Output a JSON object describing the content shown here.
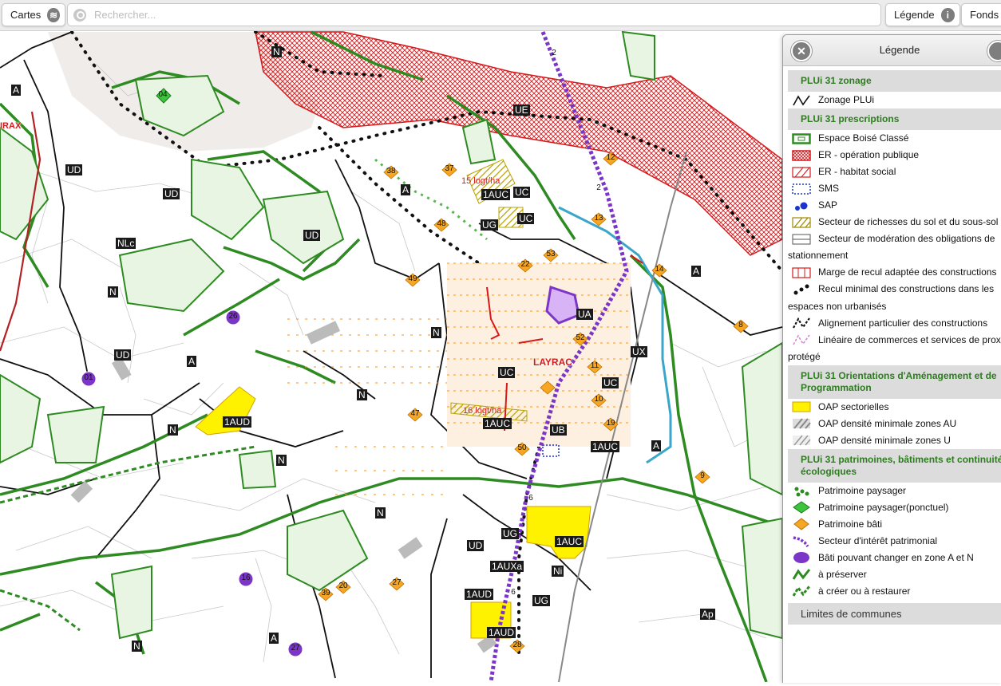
{
  "topbar": {
    "cartes_label": "Cartes",
    "search_placeholder": "Rechercher...",
    "legende_label": "Légende",
    "fonds_label": "Fonds"
  },
  "map": {
    "town_name": "LAYRAC",
    "density_labels": [
      "15 logt/ha",
      "16 logt/ha"
    ],
    "zone_labels": [
      "N",
      "A",
      "UD",
      "UD",
      "NLc",
      "N",
      "UD",
      "UD",
      "A",
      "N",
      "1AUD",
      "N",
      "N",
      "UE",
      "A",
      "1AUC",
      "UC",
      "UC",
      "UG",
      "UA",
      "UC",
      "UX",
      "UC",
      "1AUC",
      "UB",
      "1AUC",
      "A",
      "A",
      "N",
      "UG",
      "UD",
      "1AUC",
      "1AUXa",
      "Ni",
      "1AUD",
      "UG",
      "1AUD",
      "Ap",
      "A",
      "N",
      "N"
    ],
    "left_edge_label": "IRAX",
    "numbered_badges": [
      "04",
      "38",
      "37",
      "12",
      "2",
      "2",
      "13",
      "48",
      "22",
      "53",
      "14",
      "49",
      "26",
      "8",
      "52",
      "11",
      "01",
      "47",
      "10",
      "19",
      "50",
      "9",
      "6",
      "16",
      "39",
      "20",
      "27",
      "6",
      "28",
      "27"
    ]
  },
  "legend": {
    "title": "Légende",
    "sections": [
      {
        "title": "PLUi 31 zonage",
        "items": [
          {
            "icon": "zonage-line-icon",
            "label": "Zonage PLUi"
          }
        ]
      },
      {
        "title": "PLUi 31 prescriptions",
        "items": [
          {
            "icon": "ebc-icon",
            "label": "Espace Boisé Classé"
          },
          {
            "icon": "er-public-icon",
            "label": "ER - opération publique"
          },
          {
            "icon": "er-social-icon",
            "label": "ER - habitat social"
          },
          {
            "icon": "sms-icon",
            "label": "SMS"
          },
          {
            "icon": "sap-icon",
            "label": "SAP"
          },
          {
            "icon": "richesses-icon",
            "label": "Secteur de richesses du sol et du sous-sol"
          },
          {
            "icon": "stationnement-icon",
            "label": "Secteur de modération des obligations de stationnement"
          },
          {
            "icon": "recul-icon",
            "label": "Marge de recul adaptée des constructions"
          },
          {
            "icon": "recul-min-icon",
            "label": "Recul minimal des constructions dans les espaces non urbanisés"
          },
          {
            "icon": "alignement-icon",
            "label": "Alignement particulier des constructions"
          },
          {
            "icon": "lineaire-icon",
            "label": "Linéaire de commerces et services de proximité protégé"
          }
        ]
      },
      {
        "title": "PLUi 31 Orientations d'Aménagement et de Programmation",
        "items": [
          {
            "icon": "oap-sect-icon",
            "label": "OAP sectorielles"
          },
          {
            "icon": "oap-au-icon",
            "label": "OAP densité minimale zones AU"
          },
          {
            "icon": "oap-u-icon",
            "label": "OAP densité minimale zones U"
          }
        ]
      },
      {
        "title": "PLUi 31 patrimoines, bâtiments et continuités écologiques",
        "items": [
          {
            "icon": "pat-paysager-icon",
            "label": "Patrimoine paysager"
          },
          {
            "icon": "pat-ponctuel-icon",
            "label": "Patrimoine paysager(ponctuel)"
          },
          {
            "icon": "pat-bati-icon",
            "label": "Patrimoine bâti"
          },
          {
            "icon": "secteur-patrimonial-icon",
            "label": "Secteur d'intérêt patrimonial"
          },
          {
            "icon": "bati-changer-icon",
            "label": "Bâti pouvant changer en zone A et N"
          },
          {
            "icon": "preserver-icon",
            "label": "à préserver"
          },
          {
            "icon": "creer-icon",
            "label": "à créer ou à restaurer"
          }
        ]
      },
      {
        "title": "Limites de communes",
        "items": []
      }
    ],
    "colors": {
      "green": "#2e8b22",
      "red": "#d7191c",
      "purple": "#7b35c7",
      "orange": "#f29421",
      "yellow": "#fff200"
    }
  }
}
